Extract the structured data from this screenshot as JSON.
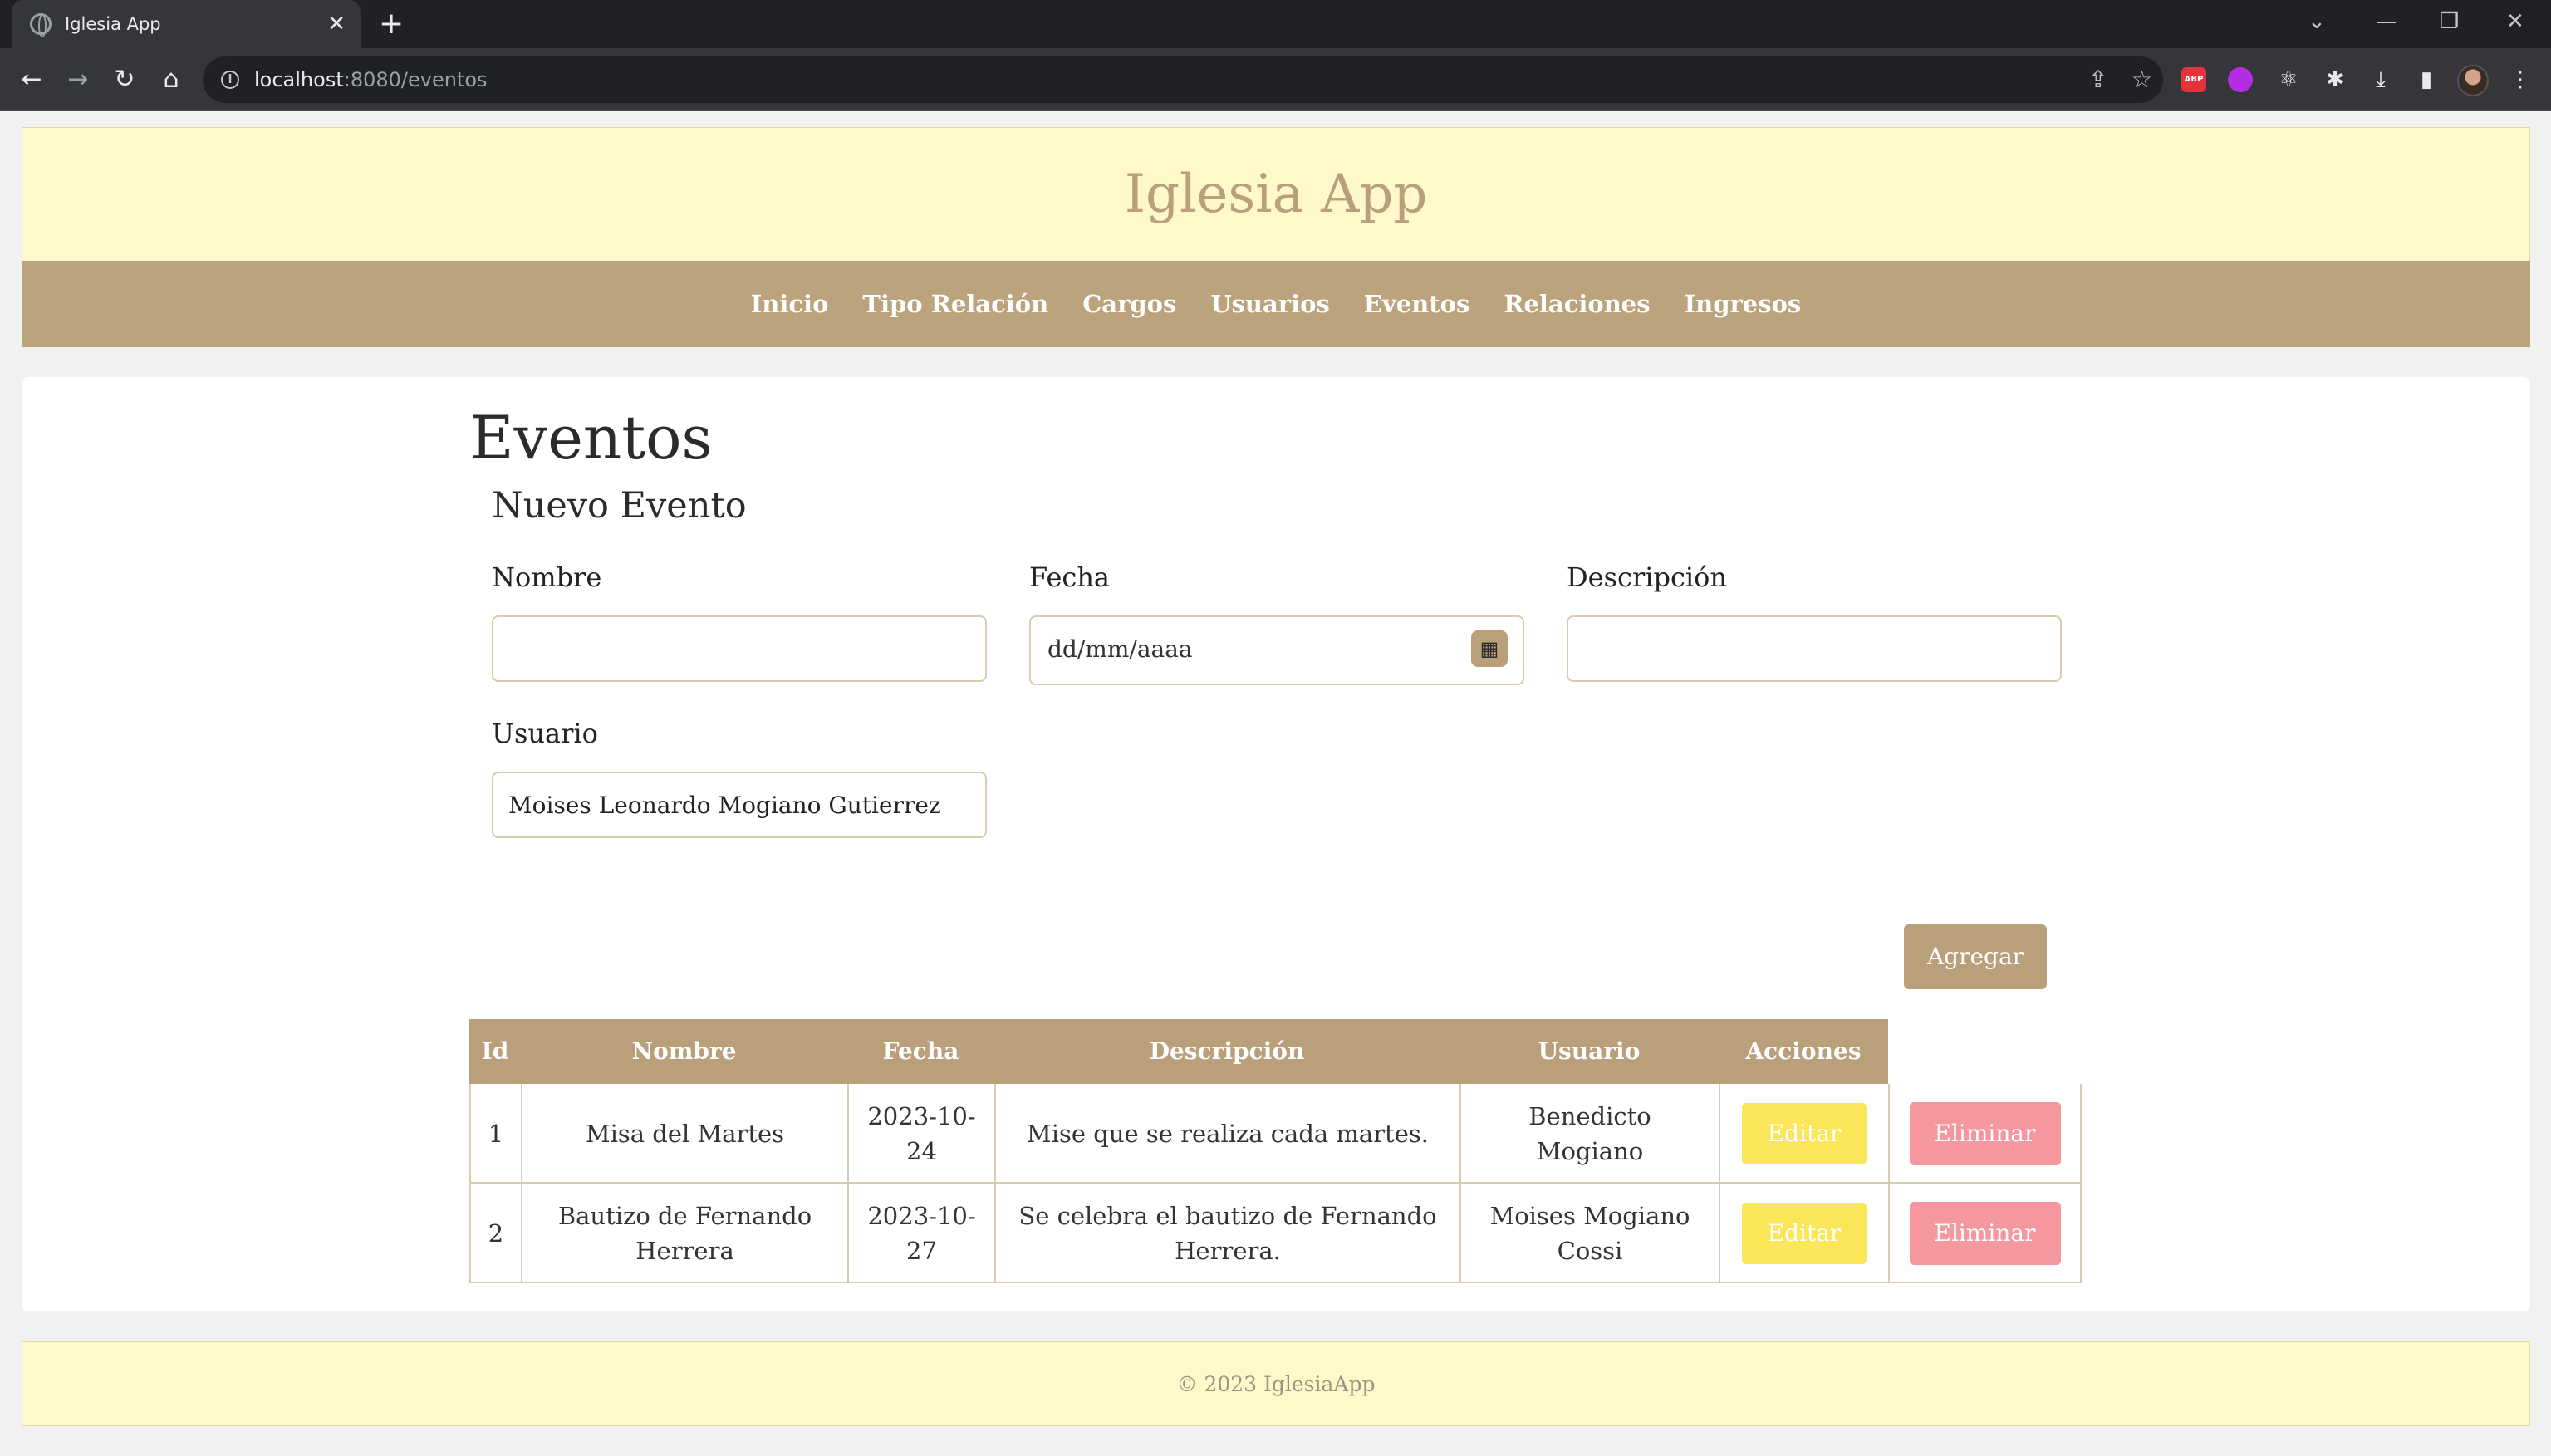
{
  "browser": {
    "tab_title": "Iglesia App",
    "tab_close": "✕",
    "new_tab": "+",
    "url_host": "localhost",
    "url_rest": ":8080/eventos",
    "abp_label": "ABP",
    "icons": [
      "back-icon",
      "forward-icon",
      "reload-icon",
      "home-icon",
      "info-icon",
      "share-icon",
      "star-icon",
      "react-icon",
      "extensions-icon",
      "download-icon",
      "side-panel-icon",
      "menu-icon"
    ]
  },
  "header": {
    "app_title": "Iglesia App"
  },
  "nav": {
    "items": [
      "Inicio",
      "Tipo Relación",
      "Cargos",
      "Usuarios",
      "Eventos",
      "Relaciones",
      "Ingresos"
    ]
  },
  "main": {
    "page_title": "Eventos",
    "form_title": "Nuevo Evento",
    "fields": {
      "nombre_label": "Nombre",
      "nombre_value": "",
      "fecha_label": "Fecha",
      "fecha_placeholder": "dd/mm/aaaa",
      "descripcion_label": "Descripción",
      "descripcion_value": "",
      "usuario_label": "Usuario",
      "usuario_value": "Moises Leonardo Mogiano Gutierrez"
    },
    "add_button": "Agregar"
  },
  "table": {
    "headers": [
      "Id",
      "Nombre",
      "Fecha",
      "Descripción",
      "Usuario",
      "Acciones"
    ],
    "rows": [
      {
        "id": "1",
        "nombre": "Misa del Martes",
        "fecha": "2023-10-24",
        "descripcion": "Mise que se realiza cada martes.",
        "usuario": "Benedicto Mogiano"
      },
      {
        "id": "2",
        "nombre": "Bautizo de Fernando Herrera",
        "fecha": "2023-10-27",
        "descripcion": "Se celebra el bautizo de Fernando Herrera.",
        "usuario": "Moises Mogiano Cossi"
      }
    ],
    "edit_label": "Editar",
    "delete_label": "Eliminar"
  },
  "footer": {
    "text": "© 2023 IglesiaApp"
  },
  "colors": {
    "header_bg": "#fff8c8",
    "nav_bg": "#bba37e",
    "accent": "#b9a07a",
    "edit": "#fbe659",
    "delete": "#f5979e"
  }
}
